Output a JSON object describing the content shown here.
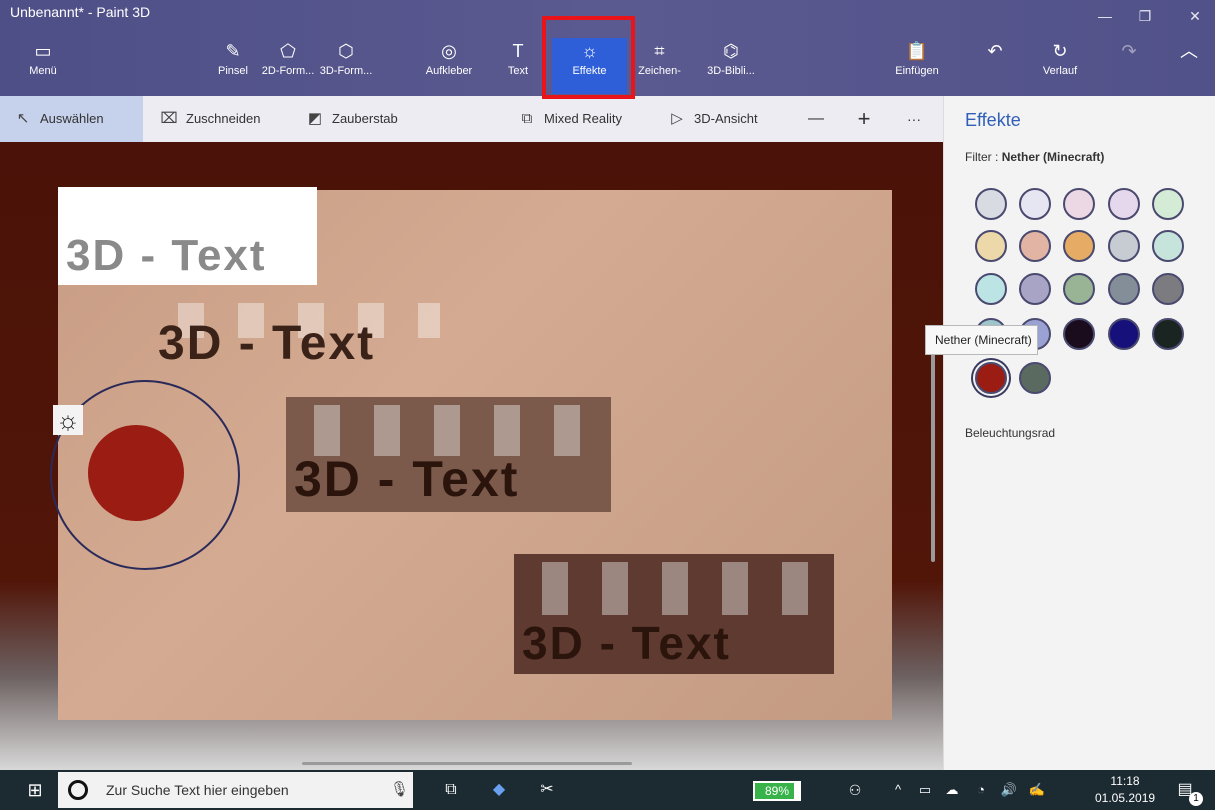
{
  "app": {
    "title": "Unbenannt* - Paint 3D"
  },
  "window_controls": {
    "minimize": "—",
    "restore": "❐",
    "close": "✕"
  },
  "ribbon": {
    "menu": {
      "icon": "▭",
      "label": "Menü"
    },
    "pinsel": {
      "icon": "✎",
      "label": "Pinsel"
    },
    "shapes2d": {
      "icon": "⬠",
      "label": "2D-Form..."
    },
    "shapes3d": {
      "icon": "⬡",
      "label": "3D-Form..."
    },
    "sticker": {
      "icon": "◎",
      "label": "Aufkleber"
    },
    "text": {
      "icon": "T",
      "label": "Text"
    },
    "effects": {
      "icon": "☼",
      "label": "Effekte"
    },
    "canvas": {
      "icon": "⌗",
      "label": "Zeichen-"
    },
    "library": {
      "icon": "⌬",
      "label": "3D-Bibli..."
    },
    "paste": {
      "icon": "📋",
      "label": "Einfügen"
    },
    "undo": {
      "icon": "↶",
      "label": ""
    },
    "history": {
      "icon": "↻",
      "label": "Verlauf"
    },
    "redo": {
      "icon": "↷",
      "label": ""
    },
    "collapse": {
      "icon": "︿",
      "label": ""
    }
  },
  "toolbar": {
    "select": {
      "icon": "↖",
      "label": "Auswählen"
    },
    "crop": {
      "icon": "⌧",
      "label": "Zuschneiden"
    },
    "magic": {
      "icon": "◩",
      "label": "Zauberstab"
    },
    "mixed": {
      "icon": "⧉",
      "label": "Mixed Reality"
    },
    "view3d": {
      "icon": "▷",
      "label": "3D-Ansicht"
    },
    "zoom_out": "—",
    "zoom_in": "+",
    "more": "···"
  },
  "canvas": {
    "text_objects": [
      "3D - Text",
      "3D - Text",
      "3D - Text",
      "3D - Text"
    ]
  },
  "panel": {
    "title": "Effekte",
    "filter_label": "Filter :",
    "filter_value": "Nether (Minecraft)",
    "swatches": [
      "#d8dbe2",
      "#e6e6f2",
      "#ecd8e4",
      "#e6d8ec",
      "#d4ecd6",
      "#ecd8a8",
      "#e2b4a4",
      "#e6ac66",
      "#c6ccd2",
      "#c6e4dc",
      "#bce4e4",
      "#a8a4c6",
      "#98b494",
      "#848e98",
      "#7c7c80",
      "#9ec4cc",
      "#9aa2d4",
      "#1a0c1c",
      "#16107a",
      "#1a2420",
      "#9a1c12",
      "#5a6a60"
    ],
    "tooltip": "Nether (Minecraft)",
    "light_label": "Beleuchtungsrad",
    "sun_icon": "☼",
    "light_color": "#9a1c12"
  },
  "taskbar": {
    "start_icon": "⊞",
    "search_placeholder": "Zur Suche Text hier eingeben",
    "mic_icon": "🎙",
    "taskview_icon": "⧉",
    "paint3d_icon": "◆",
    "snip_icon": "✂",
    "battery_percent": "89%",
    "battery_level": 0.89,
    "people_icon": "⚇",
    "tray": [
      "^",
      "▭",
      "☁",
      "◔",
      "🔊",
      "✍"
    ],
    "time": "11:18",
    "date": "01.05.2019",
    "notification_count": "1"
  }
}
